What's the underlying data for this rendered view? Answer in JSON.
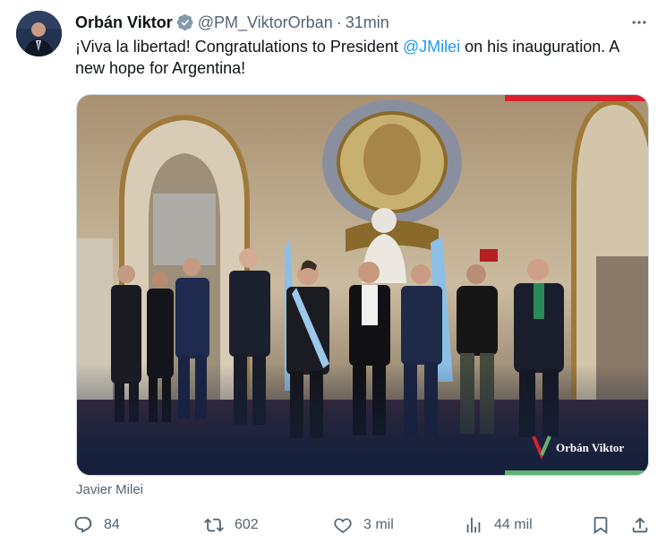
{
  "tweet": {
    "author_name": "Orbán Viktor",
    "handle": "@PM_ViktorOrban",
    "separator": "·",
    "time": "31min",
    "text_before": "¡Viva la libertad! Congratulations to President ",
    "mention": "@JMilei",
    "text_after": " on his inauguration. A new hope for Argentina!",
    "media_watermark": "Orbán Viktor",
    "media_caption": "Javier Milei"
  },
  "actions": {
    "replies": "84",
    "reposts": "602",
    "likes": "3 mil",
    "views": "44 mil"
  },
  "colors": {
    "accent": "#1d9bf0",
    "secondary_text": "#536471",
    "verified_badge": "#829aab",
    "watermark_red": "#d8202e",
    "watermark_green": "#5fb371"
  }
}
